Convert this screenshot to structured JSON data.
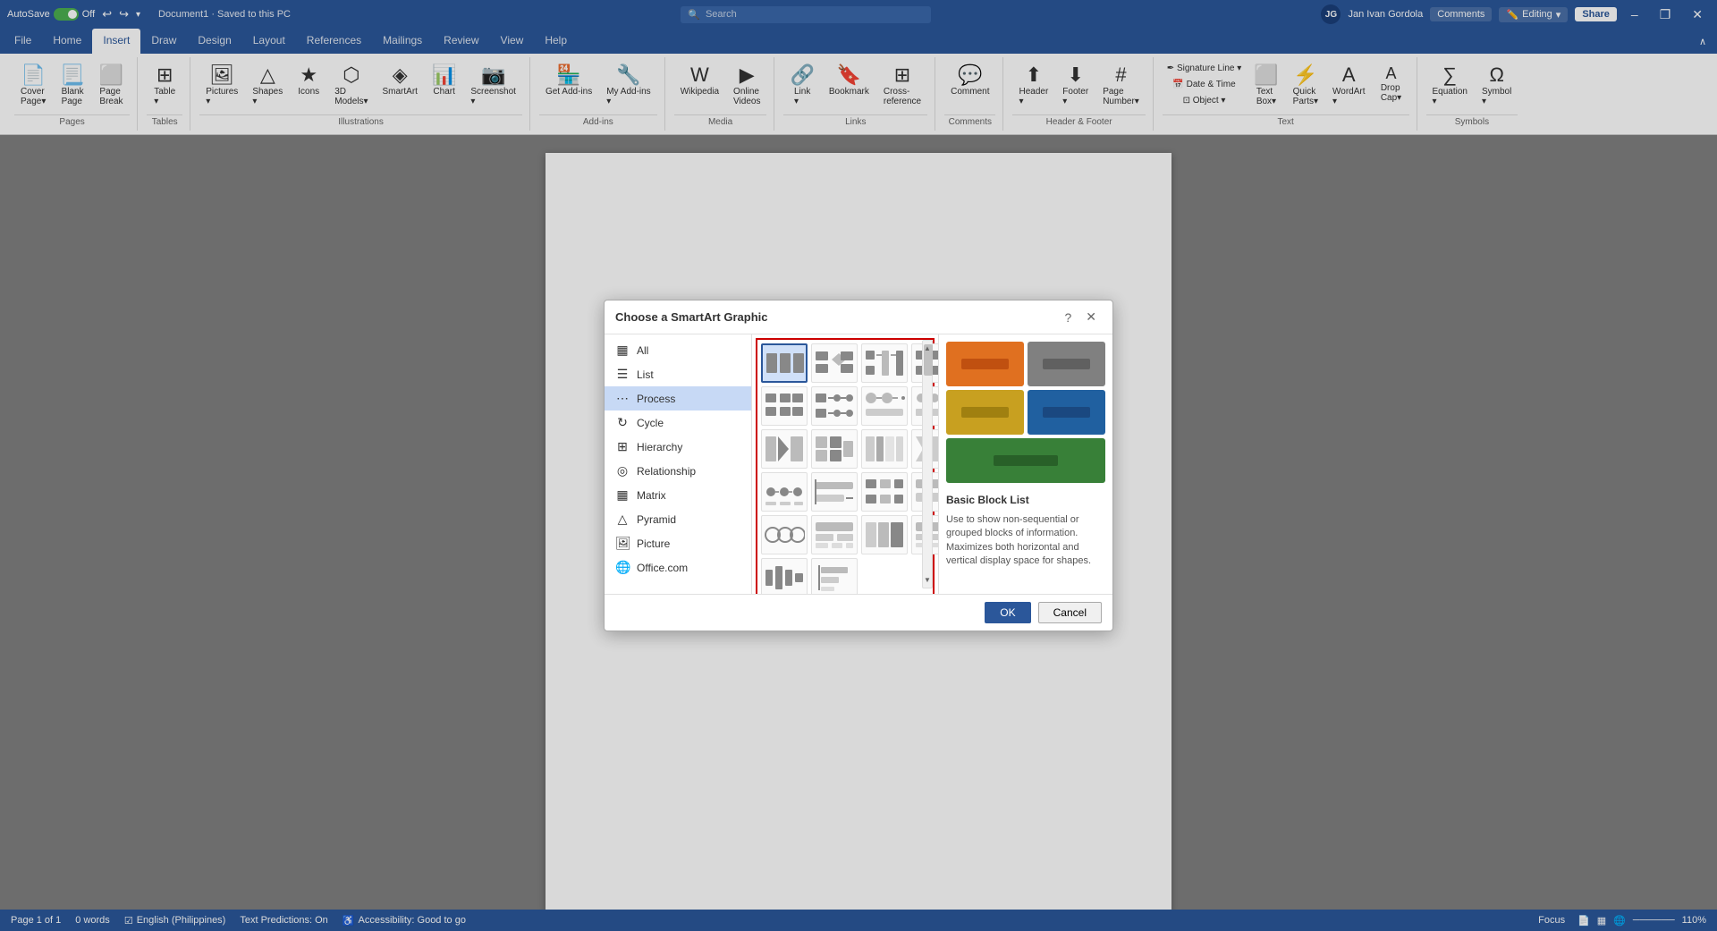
{
  "titlebar": {
    "autosave_label": "AutoSave",
    "autosave_state": "Off",
    "doc_title": "Document1 · Saved to this PC",
    "search_placeholder": "Search",
    "user_name": "Jan Ivan Gordola",
    "user_initials": "JG",
    "editing_label": "Editing",
    "comments_label": "Comments",
    "share_label": "Share",
    "minimize": "–",
    "restore": "❐",
    "close": "✕"
  },
  "ribbon": {
    "tabs": [
      "File",
      "Home",
      "Insert",
      "Draw",
      "Design",
      "Layout",
      "References",
      "Mailings",
      "Review",
      "View",
      "Help"
    ],
    "active_tab": "Insert",
    "groups": {
      "pages": {
        "label": "Pages",
        "items": [
          "Cover Page",
          "Blank Page",
          "Page Break"
        ]
      },
      "tables": {
        "label": "Tables",
        "item": "Table"
      },
      "illustrations": {
        "label": "Illustrations",
        "items": [
          "Pictures",
          "Shapes",
          "Icons",
          "3D Models",
          "SmartArt",
          "Chart",
          "Screenshot"
        ]
      },
      "addins": {
        "label": "Add-ins",
        "items": [
          "Get Add-ins",
          "My Add-ins"
        ]
      },
      "media": {
        "label": "Media",
        "items": [
          "Wikipedia",
          "Online Videos"
        ]
      },
      "links": {
        "label": "Links",
        "items": [
          "Link",
          "Bookmark",
          "Cross-reference"
        ]
      },
      "comments": {
        "label": "Comments",
        "items": [
          "Comment"
        ]
      },
      "headerfooter": {
        "label": "Header & Footer",
        "items": [
          "Header",
          "Footer",
          "Page Number"
        ]
      },
      "text": {
        "label": "Text",
        "items": [
          "Text Box",
          "Quick Parts",
          "WordArt",
          "Drop Cap"
        ]
      },
      "symbols": {
        "label": "Symbols",
        "items": [
          "Equation",
          "Symbol"
        ]
      }
    }
  },
  "dialog": {
    "title": "Choose a SmartArt Graphic",
    "help_btn": "?",
    "close_btn": "✕",
    "categories": [
      {
        "id": "all",
        "label": "All",
        "icon": "▦"
      },
      {
        "id": "list",
        "label": "List",
        "icon": "☰"
      },
      {
        "id": "process",
        "label": "Process",
        "icon": "⋯"
      },
      {
        "id": "cycle",
        "label": "Cycle",
        "icon": "↻"
      },
      {
        "id": "hierarchy",
        "label": "Hierarchy",
        "icon": "⊞"
      },
      {
        "id": "relationship",
        "label": "Relationship",
        "icon": "◎"
      },
      {
        "id": "matrix",
        "label": "Matrix",
        "icon": "▦"
      },
      {
        "id": "pyramid",
        "label": "Pyramid",
        "icon": "△"
      },
      {
        "id": "picture",
        "label": "Picture",
        "icon": "🖼"
      },
      {
        "id": "office",
        "label": "Office.com",
        "icon": "🌐"
      }
    ],
    "selected_category": "process",
    "preview": {
      "name": "Basic Block List",
      "description": "Use to show non-sequential or grouped blocks of information. Maximizes both horizontal and vertical display space for shapes."
    },
    "ok_label": "OK",
    "cancel_label": "Cancel"
  },
  "statusbar": {
    "page": "Page 1 of 1",
    "words": "0 words",
    "lang": "English (Philippines)",
    "text_predictions": "Text Predictions: On",
    "accessibility": "Accessibility: Good to go",
    "focus": "Focus",
    "zoom": "110%"
  }
}
